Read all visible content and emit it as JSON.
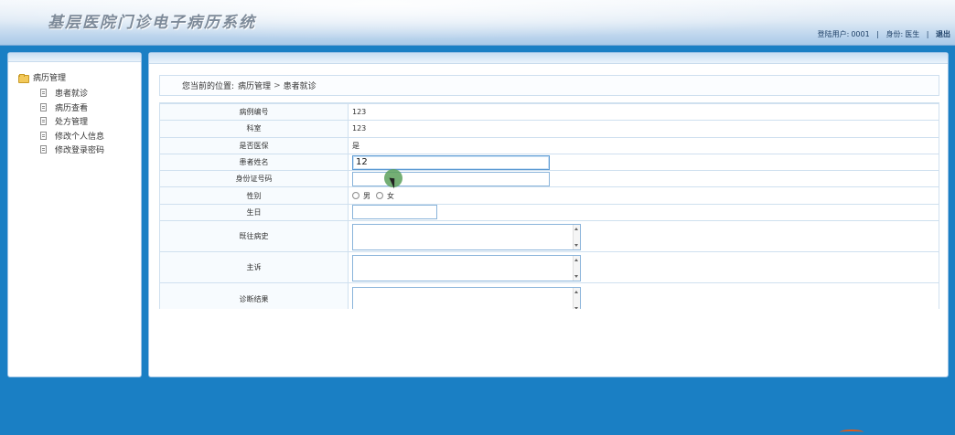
{
  "header": {
    "app_title": "基层医院门诊电子病历系统",
    "login_user_label": "登陆用户:",
    "login_user_value": "0001",
    "role_label": "身份:",
    "role_value": "医生",
    "separator": "|",
    "logout": "退出"
  },
  "sidebar": {
    "root_label": "病历管理",
    "items": [
      {
        "label": "患者就诊"
      },
      {
        "label": "病历查看"
      },
      {
        "label": "处方管理"
      },
      {
        "label": "修改个人信息"
      },
      {
        "label": "修改登录密码"
      }
    ]
  },
  "breadcrumb": {
    "prefix": "您当前的位置:",
    "level1": "病历管理",
    "arrow": ">",
    "level2": "患者就诊"
  },
  "form": {
    "case_no_label": "病例编号",
    "case_no_value": "123",
    "department_label": "科室",
    "department_value": "123",
    "insurance_label": "是否医保",
    "insurance_value": "是",
    "patient_name_label": "患者姓名",
    "patient_name_value": "12",
    "id_number_label": "身份证号码",
    "id_number_value": "",
    "gender_label": "性别",
    "gender_options": [
      "男",
      "女"
    ],
    "birthday_label": "生日",
    "birthday_value": "",
    "history_label": "既往病史",
    "complaint_label": "主诉",
    "diagnosis_label": "诊断结果"
  },
  "icons": {
    "folder": "folder-open-icon",
    "document": "document-icon"
  },
  "colors": {
    "background": "#1a7fc4",
    "border": "#9dc3e6",
    "title": "#7d8a99",
    "cursor_marker": "#5ca05c"
  }
}
